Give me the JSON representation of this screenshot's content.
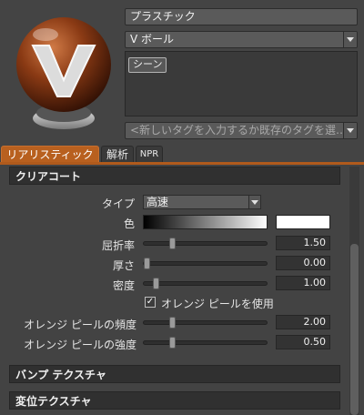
{
  "header": {
    "material_name": "プラスチック",
    "shader_type": "V ボール",
    "tag_chip": "シーン",
    "tag_placeholder": "<新しいタグを入力するか既存のタグを選…"
  },
  "tabs": [
    {
      "label": "リアリスティック",
      "active": true
    },
    {
      "label": "解析",
      "active": false
    },
    {
      "label": "NPR",
      "active": false
    }
  ],
  "sections": {
    "clearcoat": "クリアコート",
    "bump": "バンプ テクスチャ",
    "displacement": "変位テクスチャ"
  },
  "props": {
    "type_label": "タイプ",
    "type_value": "高速",
    "color_label": "色",
    "ior_label": "屈折率",
    "ior_value": "1.50",
    "ior_fraction": 0.22,
    "thickness_label": "厚さ",
    "thickness_value": "0.00",
    "thickness_fraction": 0.0,
    "density_label": "密度",
    "density_value": "1.00",
    "density_fraction": 0.08,
    "orange_peel_check": "オレンジ ピールを使用",
    "orange_peel_checked": true,
    "freq_label": "オレンジ ピールの頻度",
    "freq_value": "2.00",
    "freq_fraction": 0.22,
    "strength_label": "オレンジ ピールの強度",
    "strength_value": "0.50",
    "strength_fraction": 0.22
  },
  "icons": {
    "checkbox_glyph": "✓"
  },
  "colors": {
    "accent": "#b8601f",
    "sphere": "#8a3a14"
  }
}
